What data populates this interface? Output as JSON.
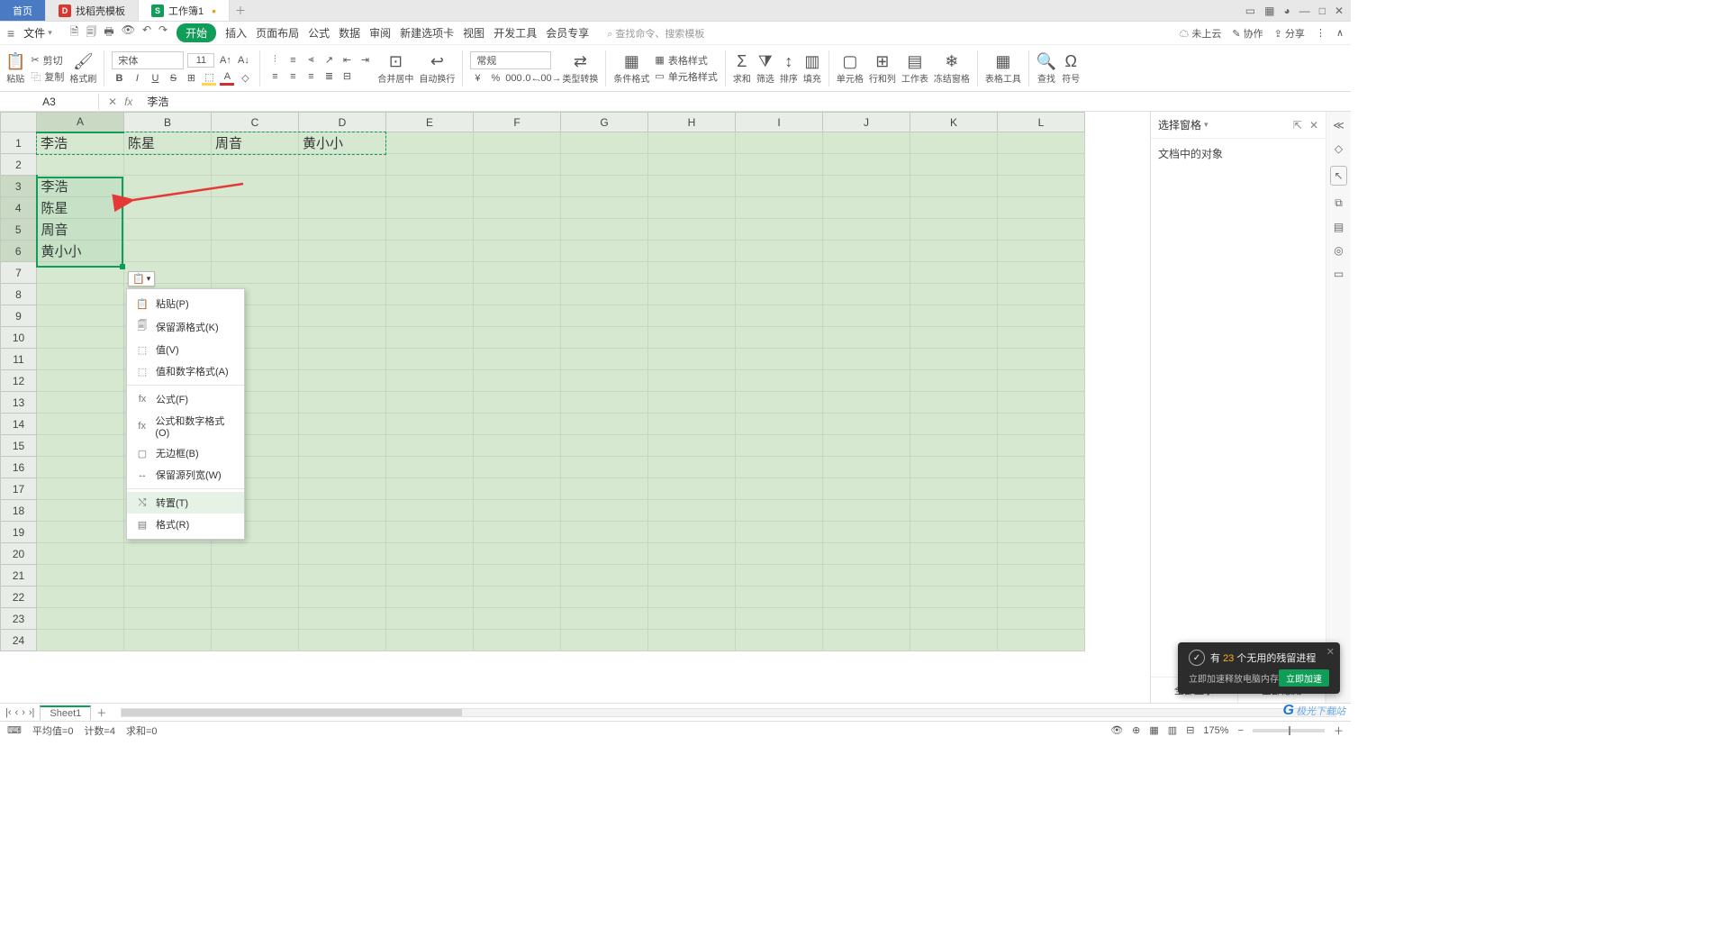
{
  "tabs": {
    "home": "首页",
    "tpl": "找稻壳模板",
    "wb": "工作簿1"
  },
  "menu": {
    "file": "文件",
    "items": [
      "开始",
      "插入",
      "页面布局",
      "公式",
      "数据",
      "审阅",
      "新建选项卡",
      "视图",
      "开发工具",
      "会员专享"
    ],
    "search_ph": "查找命令、搜索模板",
    "cloud": "未上云",
    "coop": "协作",
    "share": "分享"
  },
  "ribbon": {
    "paste": "粘贴",
    "cut": "剪切",
    "copy": "复制",
    "brush": "格式刷",
    "font_name": "宋体",
    "font_size": "11",
    "merge": "合并居中",
    "wrap": "自动换行",
    "numfmt": "常规",
    "typeconv": "类型转换",
    "condfmt": "条件格式",
    "tbstyle": "表格样式",
    "cellstyle": "单元格样式",
    "sum": "求和",
    "filter": "筛选",
    "sort": "排序",
    "fill": "填充",
    "cell": "单元格",
    "rowcol": "行和列",
    "ws": "工作表",
    "freeze": "冻结窗格",
    "tbtool": "表格工具",
    "find": "查找",
    "symbol": "符号"
  },
  "fx": {
    "cellref": "A3",
    "val": "李浩"
  },
  "cols": [
    "A",
    "B",
    "C",
    "D",
    "E",
    "F",
    "G",
    "H",
    "I",
    "J",
    "K",
    "L"
  ],
  "cells": {
    "r1": [
      "李浩",
      "陈星",
      "周音",
      "黄小小"
    ],
    "a3": "李浩",
    "a4": "陈星",
    "a5": "周音",
    "a6": "黄小小"
  },
  "ctx": {
    "paste": "粘贴(P)",
    "keepfmt": "保留源格式(K)",
    "val": "值(V)",
    "valnum": "值和数字格式(A)",
    "formula": "公式(F)",
    "fmlnum": "公式和数字格式(O)",
    "nobd": "无边框(B)",
    "colw": "保留源列宽(W)",
    "trans": "转置(T)",
    "fmt": "格式(R)"
  },
  "selpane": {
    "title": "选择窗格",
    "obj": "文档中的对象",
    "showall": "全部显示",
    "hideall": "全部隐藏"
  },
  "sheet": {
    "name": "Sheet1"
  },
  "status": {
    "avg": "平均值=0",
    "count": "计数=4",
    "sum": "求和=0",
    "zoom": "175%"
  },
  "toast": {
    "pre": "有 ",
    "num": "23",
    "post": " 个无用的残留进程",
    "sub": "立即加速释放电脑内存",
    "btn": "立即加速"
  },
  "watermark": "极光下载站"
}
